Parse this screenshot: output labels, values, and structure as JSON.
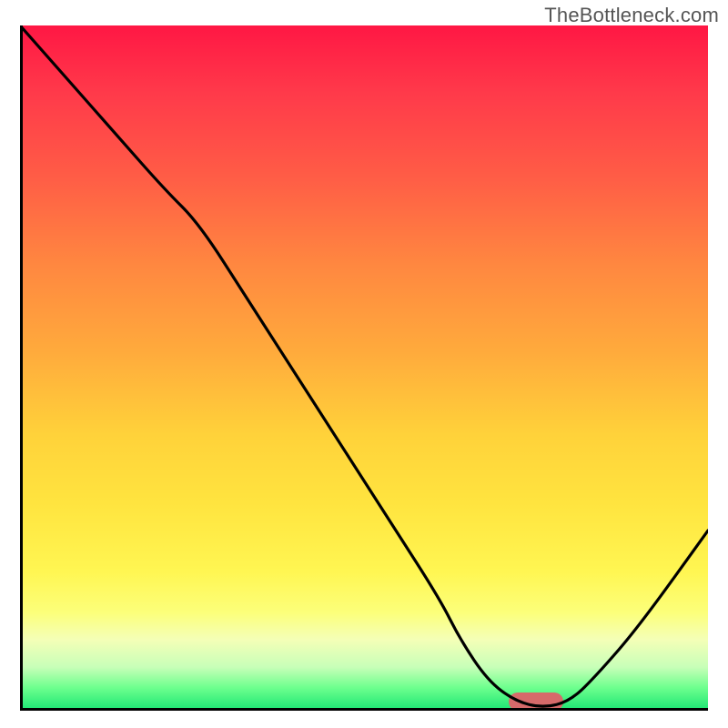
{
  "watermark": "TheBottleneck.com",
  "chart_data": {
    "type": "line",
    "title": "",
    "xlabel": "",
    "ylabel": "",
    "x_range": [
      0,
      100
    ],
    "y_range": [
      0,
      100
    ],
    "grid": false,
    "series": [
      {
        "name": "bottleneck-curve",
        "x": [
          0,
          7,
          14,
          21,
          26,
          33,
          40,
          47,
          54,
          61,
          64,
          68,
          72,
          76,
          80,
          84,
          90,
          100
        ],
        "y": [
          100,
          92,
          84,
          76,
          71,
          60,
          49,
          38,
          27,
          16,
          10,
          4,
          1,
          0,
          1,
          5,
          12,
          26
        ]
      }
    ],
    "annotations": [
      {
        "name": "optimal-marker",
        "x": 75,
        "y": 1,
        "color": "#d66a6a",
        "shape": "pill"
      }
    ],
    "background_gradient": {
      "stops": [
        {
          "pct": 0,
          "color": "#ff1744"
        },
        {
          "pct": 48,
          "color": "#ffab3c"
        },
        {
          "pct": 80,
          "color": "#fff652"
        },
        {
          "pct": 100,
          "color": "#23e876"
        }
      ]
    }
  }
}
